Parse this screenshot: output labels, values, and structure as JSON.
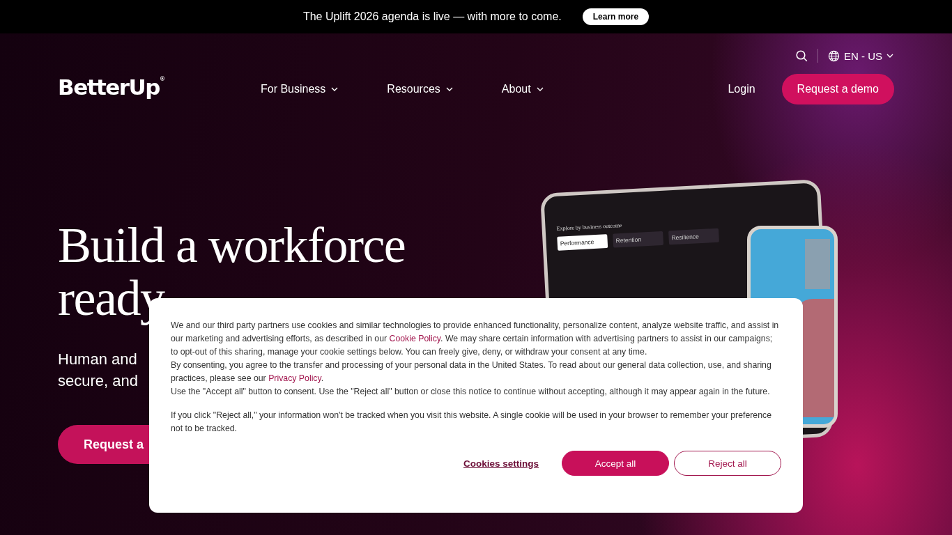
{
  "announcement": {
    "text": "The Uplift 2026 agenda is live — with more to come.",
    "button": "Learn more"
  },
  "nav": {
    "logo": "BetterUp",
    "logo_mark": "®",
    "language": "EN - US",
    "items": [
      {
        "label": "For Business"
      },
      {
        "label": "Resources"
      },
      {
        "label": "About"
      }
    ],
    "login": "Login",
    "cta": "Request a demo"
  },
  "hero": {
    "heading_lines": [
      "Build a workforce",
      "ready"
    ],
    "subtitle_lines": [
      "Human and",
      "secure, and"
    ],
    "button": "Request a"
  },
  "mockup": {
    "prompt": "Explore by business outcome",
    "tabs": [
      {
        "label": "Performance",
        "selected": true
      },
      {
        "label": "Retention",
        "selected": false
      },
      {
        "label": "Resilience",
        "selected": false
      }
    ]
  },
  "cookie_banner": {
    "blocks": [
      [
        {
          "kind": "text",
          "text": "We and our third party partners use cookies and similar technologies to provide enhanced functionality, personalize content, analyze website traffic, and assist in our marketing and advertising efforts, as described in our "
        },
        {
          "kind": "link",
          "text": "Cookie Policy"
        },
        {
          "kind": "text",
          "text": ". We may share certain information with advertising partners to assist in our campaigns; to opt-out of this sharing, manage your cookie settings below. You can freely give, deny, or withdraw your consent at any time."
        }
      ],
      [
        {
          "kind": "text",
          "text": "By consenting, you agree to the transfer and processing of your personal data in the United States. To read about our general data collection, use, and sharing practices, please see our "
        },
        {
          "kind": "link",
          "text": "Privacy Policy"
        },
        {
          "kind": "text",
          "text": "."
        }
      ],
      [
        {
          "kind": "text",
          "text": "Use the \"Accept all\" button to consent. Use the \"Reject all\" button or close this notice to continue without accepting, although it may appear again in the future."
        }
      ],
      [
        {
          "kind": "text",
          "text": "If you click \"Reject all,\" your information won't be tracked when you visit this website. A single cookie will be used in your browser to remember your preference not to be tracked."
        }
      ]
    ],
    "settings": "Cookies settings",
    "accept": "Accept all",
    "reject": "Reject all"
  }
}
